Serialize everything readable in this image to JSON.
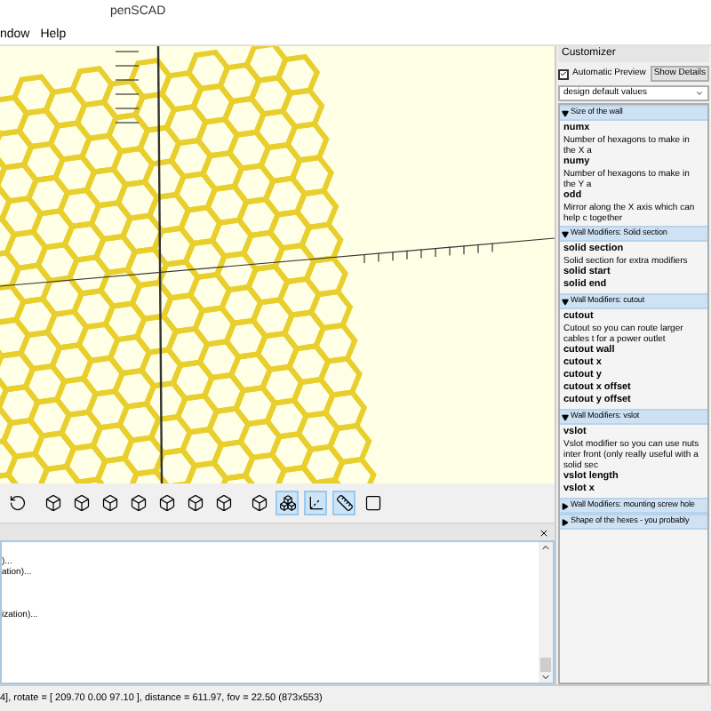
{
  "window": {
    "title": "penSCAD"
  },
  "menu": [
    "ndow",
    "Help"
  ],
  "toolbar": [
    {
      "kind": "reset",
      "selected": false
    },
    {
      "kind": "view",
      "selected": false
    },
    {
      "kind": "view",
      "selected": false
    },
    {
      "kind": "view",
      "selected": false
    },
    {
      "kind": "view",
      "selected": false
    },
    {
      "kind": "view",
      "selected": false
    },
    {
      "kind": "view",
      "selected": false
    },
    {
      "kind": "view",
      "selected": false
    },
    {
      "kind": "perspective",
      "selected": false
    },
    {
      "kind": "orthogonal",
      "selected": true
    },
    {
      "kind": "axes",
      "selected": true
    },
    {
      "kind": "scale",
      "selected": true
    },
    {
      "kind": "edges",
      "selected": false
    }
  ],
  "console": {
    "blocks": [
      [
        ")...",
        "ation)..."
      ],
      [
        "ization)..."
      ]
    ]
  },
  "customizer": {
    "title": "Customizer",
    "automatic_preview": {
      "label": "Automatic Preview",
      "checked": true
    },
    "details_button": "Show Details",
    "preset": "design default values",
    "sections": [
      {
        "title": "Size of the wall",
        "expanded": true,
        "params": [
          {
            "name": "numx",
            "description": "Number of hexagons to make in the X a"
          },
          {
            "name": "numy",
            "description": "Number of hexagons to make in the Y a"
          },
          {
            "name": "odd",
            "description": "Mirror along the X axis which can help c together"
          }
        ]
      },
      {
        "title": "Wall Modifiers: Solid section",
        "expanded": true,
        "params": [
          {
            "name": "solid section",
            "description": "Solid section for extra modifiers"
          },
          {
            "name": "solid start"
          },
          {
            "name": "solid end"
          }
        ]
      },
      {
        "title": "Wall Modifiers: cutout",
        "expanded": true,
        "params": [
          {
            "name": "cutout",
            "description": "Cutout so you can route larger cables t for a power outlet"
          },
          {
            "name": "cutout wall"
          },
          {
            "name": "cutout x"
          },
          {
            "name": "cutout y"
          },
          {
            "name": "cutout x offset"
          },
          {
            "name": "cutout y offset"
          }
        ]
      },
      {
        "title": "Wall Modifiers: vslot",
        "expanded": true,
        "params": [
          {
            "name": "vslot",
            "description": "Vslot modifier so you can use nuts inter front (only really useful with a solid sec"
          },
          {
            "name": "vslot length"
          },
          {
            "name": "vslot x"
          }
        ]
      },
      {
        "title": "Wall Modifiers: mounting screw hole",
        "expanded": false
      },
      {
        "title": "Shape of the hexes - you probably",
        "expanded": false
      }
    ]
  },
  "status_bar": "4], rotate = [ 209.70 0.00 97.10 ], distance = 611.97, fov = 22.50 (873x553)"
}
